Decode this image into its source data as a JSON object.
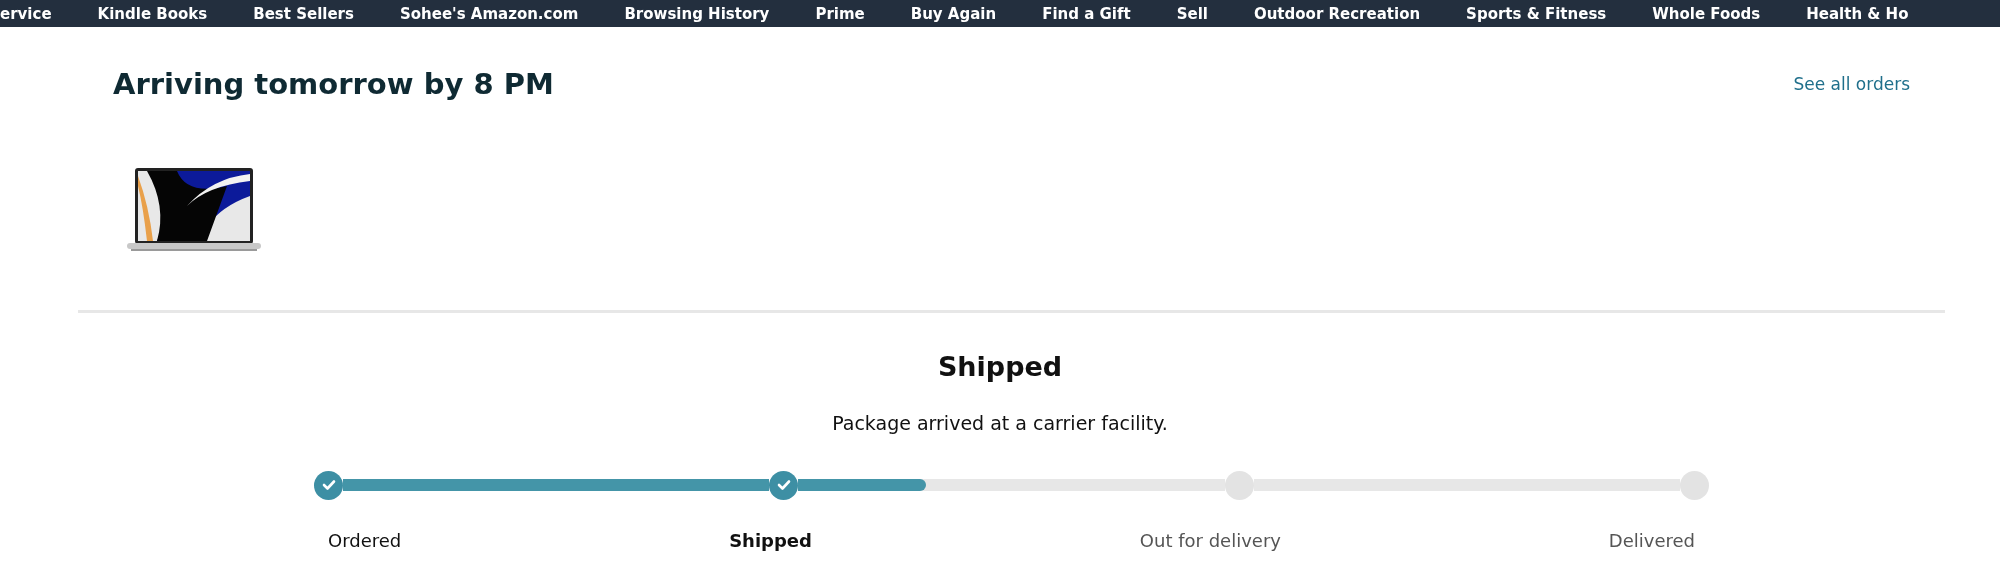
{
  "nav": [
    "ervice",
    "Kindle Books",
    "Best Sellers",
    "Sohee's Amazon.com",
    "Browsing History",
    "Prime",
    "Buy Again",
    "Find a Gift",
    "Sell",
    "Outdoor Recreation",
    "Sports & Fitness",
    "Whole Foods",
    "Health & Ho"
  ],
  "heading": "Arriving tomorrow by 8 PM",
  "see_all": "See all orders",
  "status": {
    "title": "Shipped",
    "message": "Package arrived at a carrier facility.",
    "steps": [
      {
        "label": "Ordered",
        "done": true,
        "selected": false,
        "level": 1
      },
      {
        "label": "Shipped",
        "done": true,
        "selected": true,
        "level": 0.3
      },
      {
        "label": "Out for delivery",
        "done": false,
        "selected": false
      },
      {
        "label": "Delivered",
        "done": false,
        "selected": false
      }
    ]
  }
}
